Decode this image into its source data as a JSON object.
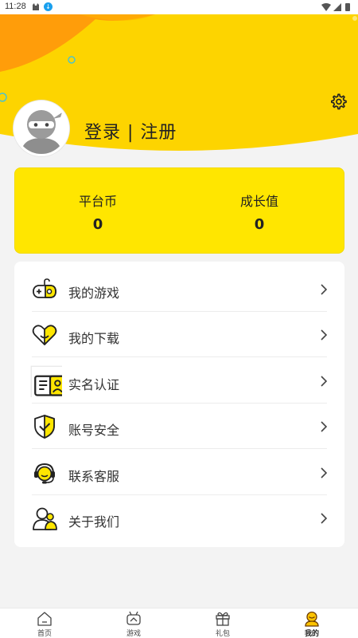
{
  "status_bar": {
    "time": "11:28"
  },
  "header": {
    "login_label": "登录 | 注册"
  },
  "stats": [
    {
      "label": "平台币",
      "value": "0"
    },
    {
      "label": "成长值",
      "value": "0"
    }
  ],
  "menu": [
    {
      "label": "我的游戏",
      "icon": "gamepad-icon"
    },
    {
      "label": "我的下载",
      "icon": "heart-download-icon"
    },
    {
      "label": "实名认证",
      "icon": "id-card-icon"
    },
    {
      "label": "账号安全",
      "icon": "shield-check-icon"
    },
    {
      "label": "联系客服",
      "icon": "headset-icon"
    },
    {
      "label": "关于我们",
      "icon": "users-icon"
    }
  ],
  "bottom_nav": [
    {
      "label": "首页",
      "icon": "home-icon",
      "active": false
    },
    {
      "label": "游戏",
      "icon": "game-icon",
      "active": false
    },
    {
      "label": "礼包",
      "icon": "gift-icon",
      "active": false
    },
    {
      "label": "我的",
      "icon": "profile-icon",
      "active": true
    }
  ],
  "colors": {
    "accent": "#ffe600",
    "header_yellow": "#fdd400",
    "orange": "#ff9d0a"
  }
}
